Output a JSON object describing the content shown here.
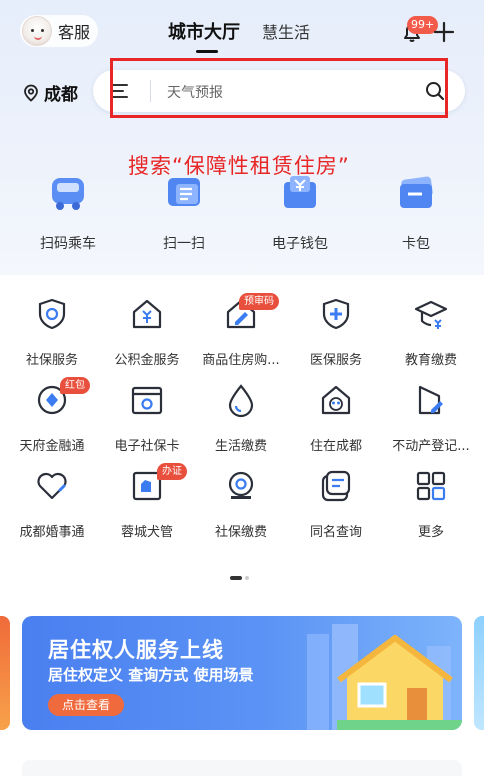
{
  "header": {
    "service_label": "客服",
    "tabs": [
      {
        "label": "城市大厅",
        "active": true
      },
      {
        "label": "慧生活",
        "active": false
      }
    ],
    "notification_badge": "99+"
  },
  "location": {
    "city": "成都"
  },
  "search": {
    "placeholder": "天气预报"
  },
  "annotation": {
    "text": "搜索“保障性租赁住房”",
    "color": "#e82626"
  },
  "quick_actions": [
    {
      "label": "扫码乘车",
      "icon": "bus-icon"
    },
    {
      "label": "扫一扫",
      "icon": "scan-icon"
    },
    {
      "label": "电子钱包",
      "icon": "wallet-icon"
    },
    {
      "label": "卡包",
      "icon": "card-icon"
    }
  ],
  "services": [
    {
      "label": "社保服务",
      "icon": "social-security-shield-icon"
    },
    {
      "label": "公积金服务",
      "icon": "housing-fund-icon"
    },
    {
      "label": "商品住房购...",
      "icon": "house-purchase-icon",
      "badge": "预审码"
    },
    {
      "label": "医保服务",
      "icon": "medical-shield-icon"
    },
    {
      "label": "教育缴费",
      "icon": "graduation-cap-icon"
    },
    {
      "label": "天府金融通",
      "icon": "finance-icon",
      "badge": "红包"
    },
    {
      "label": "电子社保卡",
      "icon": "social-card-icon"
    },
    {
      "label": "生活缴费",
      "icon": "water-drop-icon"
    },
    {
      "label": "住在成都",
      "icon": "panda-house-icon"
    },
    {
      "label": "不动产登记...",
      "icon": "property-icon"
    },
    {
      "label": "成都婚事通",
      "icon": "heart-icon"
    },
    {
      "label": "蓉城犬管",
      "icon": "dog-icon",
      "badge": "办证"
    },
    {
      "label": "社保缴费",
      "icon": "social-pay-icon"
    },
    {
      "label": "同名查询",
      "icon": "name-query-icon"
    },
    {
      "label": "更多",
      "icon": "more-grid-icon"
    }
  ],
  "banner": {
    "title": "居住权人服务上线",
    "subtitle": "居住权定义  查询方式  使用场景",
    "button": "点击查看"
  },
  "colors": {
    "accent": "#3b7cf0",
    "badge": "#e8503d",
    "annotation": "#e82626"
  }
}
